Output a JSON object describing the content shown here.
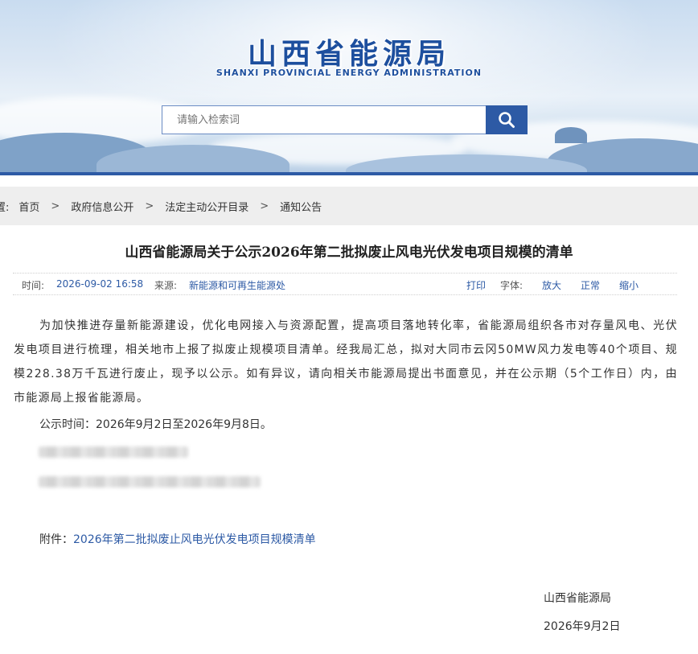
{
  "header": {
    "title": "山西省能源局",
    "subtitle": "SHANXI PROVINCIAL ENERGY ADMINISTRATION",
    "search_placeholder": "请输入检索词"
  },
  "breadcrumb": {
    "lead": "置:",
    "items": [
      "首页",
      "政府信息公开",
      "法定主动公开目录",
      "通知公告"
    ],
    "separator": ">"
  },
  "article": {
    "title": "山西省能源局关于公示2026年第二批拟废止风电光伏发电项目规模的清单",
    "meta": {
      "time_label": "时间:",
      "time_value": "2026-09-02 16:58",
      "source_label": "来源:",
      "source_value": "新能源和可再生能源处",
      "print_label": "打印",
      "font_label": "字体:",
      "font_large": "放大",
      "font_normal": "正常",
      "font_small": "缩小"
    },
    "body": "为加快推进存量新能源建设，优化电网接入与资源配置，提高项目落地转化率，省能源局组织各市对存量风电、光伏发电项目进行梳理，相关地市上报了拟废止规模项目清单。经我局汇总，拟对大同市云冈50MW风力发电等40个项目、规模228.38万千瓦进行废止，现予以公示。如有异议，请向相关市能源局提出书面意见，并在公示期（5个工作日）内，由市能源局上报省能源局。",
    "period": "公示时间：2026年9月2日至2026年9月8日。",
    "attachment_label": "附件：",
    "attachment_link": "2026年第二批拟废止风电光伏发电项目规模清单",
    "signature_org": "山西省能源局",
    "signature_date": "2026年9月2日"
  },
  "colors": {
    "brand_blue": "#2d5aa5",
    "link_blue": "#2d5aa5"
  },
  "icons": {
    "search": "search-icon"
  }
}
